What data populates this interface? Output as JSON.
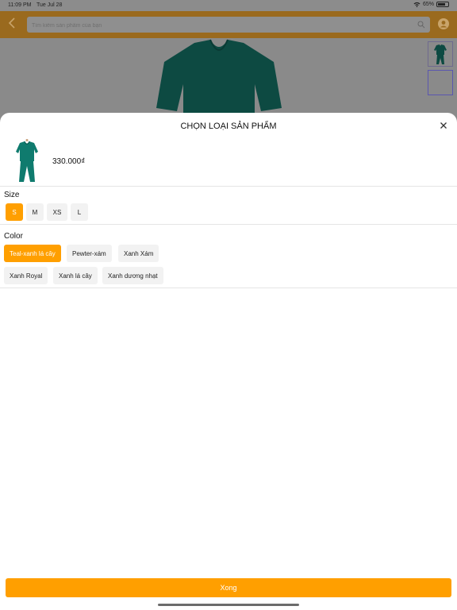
{
  "status_bar": {
    "time": "11:09 PM",
    "date": "Tue Jul 28",
    "battery": "65%"
  },
  "header": {
    "search_placeholder": "Tìm kiếm sản phẩm của bạn",
    "back_icon": "chevron-left-icon",
    "search_icon": "search-icon",
    "profile_icon": "profile-icon"
  },
  "sheet": {
    "title": "CHỌN LOẠI SẢN PHẨM",
    "price": "330.000₫",
    "size_label": "Size",
    "sizes": [
      "S",
      "M",
      "XS",
      "L"
    ],
    "selected_size": "S",
    "color_label": "Color",
    "colors": [
      "Teal-xanh lá cây",
      "Pewter-xám",
      "Xanh Xám",
      "Xanh Royal",
      "Xanh lá cây",
      "Xanh dương nhạt"
    ],
    "selected_color": "Teal-xanh lá cây",
    "done_label": "Xong"
  },
  "colors": {
    "accent": "#ff9f00",
    "scrub_teal": "#0f7b6e"
  }
}
